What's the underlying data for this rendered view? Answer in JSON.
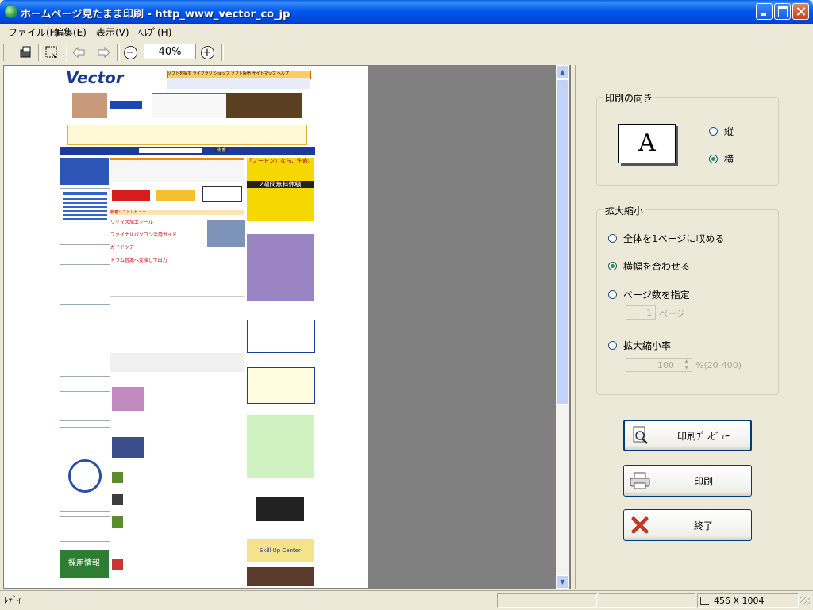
{
  "window": {
    "title": "ホームページ見たまま印刷 - http_www_vector_co_jp"
  },
  "menu": {
    "file": "ファイル(F)",
    "edit": "編集(E)",
    "view": "表示(V)",
    "help": "ﾍﾙﾌﾟ(H)"
  },
  "toolbar": {
    "zoom_value": "40%"
  },
  "preview": {
    "site_logo": "Vector",
    "nav_links": [
      "ソフトを探す",
      "ライブラリ",
      "ショップ",
      "ソフト販売",
      "サイトマップ",
      "ヘルプ"
    ],
    "search_button": "検 索",
    "banner_text": "「ノートン」なら、生命。",
    "banner_subtext": "2週間無料体験",
    "section_pickup": "新着ソフトレビュー",
    "section_titles": [
      "リサイズ加工ツール",
      "ファイナルパソコン活用ガイド",
      "ガイドツアー",
      "ドラム音源へ変換して出力"
    ],
    "bottom_banner": "採用情報",
    "skillup": "Skill Up Center"
  },
  "side": {
    "orientation": {
      "title": "印刷の向き",
      "icon_letter": "A",
      "portrait": "縦",
      "landscape": "横",
      "selected": "landscape"
    },
    "scale": {
      "title": "拡大縮小",
      "fit_page": "全体を1ページに収める",
      "fit_width": "横幅を合わせる",
      "page_count": "ページ数を指定",
      "page_count_value": "1",
      "page_count_unit": "ページ",
      "ratio": "拡大縮小率",
      "ratio_value": "100",
      "ratio_unit": "%(20-400)",
      "selected": "fit_width"
    },
    "buttons": {
      "preview": "印刷ﾌﾟﾚﾋﾞｭｰ",
      "print": "印刷",
      "exit": "終了"
    }
  },
  "status": {
    "text": "ﾚﾃﾞｨ",
    "size": "456 X 1004"
  }
}
